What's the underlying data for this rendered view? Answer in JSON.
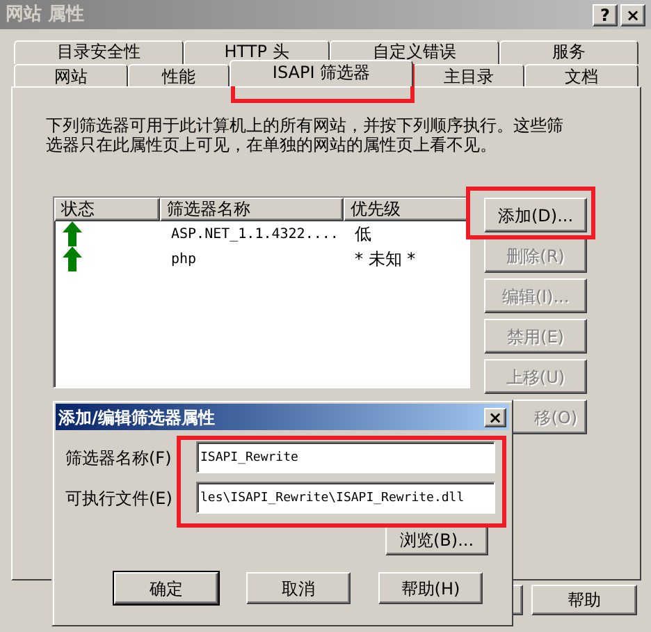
{
  "window": {
    "title": "网站 属性",
    "title_buttons": [
      "?",
      "×"
    ]
  },
  "tab_rows": [
    [
      {
        "label": "目录安全性",
        "selected": false
      },
      {
        "label": "HTTP 头",
        "selected": false
      },
      {
        "label": "自定义错误",
        "selected": false
      },
      {
        "label": "服务",
        "selected": false
      }
    ],
    [
      {
        "label": "网站",
        "selected": false
      },
      {
        "label": "性能",
        "selected": false
      },
      {
        "label": "ISAPI 筛选器",
        "selected": true
      },
      {
        "label": "主目录",
        "selected": false
      },
      {
        "label": "文档",
        "selected": false
      }
    ]
  ],
  "description": "下列筛选器可用于此计算机上的所有网站，并按下列顺序执行。这些筛选器只在此属性页上可见，在单独的网站的属性页上看不见。",
  "filter_table": {
    "columns": [
      "状态",
      "筛选器名称",
      "优先级"
    ],
    "rows": [
      {
        "name": "ASP.NET_1.1.4322....",
        "priority": "低"
      },
      {
        "name": "php",
        "priority": "* 未知 *"
      }
    ]
  },
  "side_buttons": [
    {
      "label": "添加(D)...",
      "disabled": false
    },
    {
      "label": "删除(R)",
      "disabled": true
    },
    {
      "label": "编辑(I)...",
      "disabled": true
    },
    {
      "label": "禁用(E)",
      "disabled": true
    },
    {
      "label": "上移(U)",
      "disabled": true
    },
    {
      "label": "移(O)",
      "disabled": true
    }
  ],
  "bottom_buttons": [
    "帮助"
  ],
  "dialog": {
    "title": "添加/编辑筛选器属性",
    "close": "×",
    "fields": [
      {
        "label": "筛选器名称(F)",
        "value": "ISAPI_Rewrite"
      },
      {
        "label": "可执行文件(E)",
        "value": "les\\ISAPI_Rewrite\\ISAPI_Rewrite.dll"
      }
    ],
    "browse": "浏览(B)...",
    "buttons": [
      "确定",
      "取消",
      "帮助(H)"
    ]
  }
}
